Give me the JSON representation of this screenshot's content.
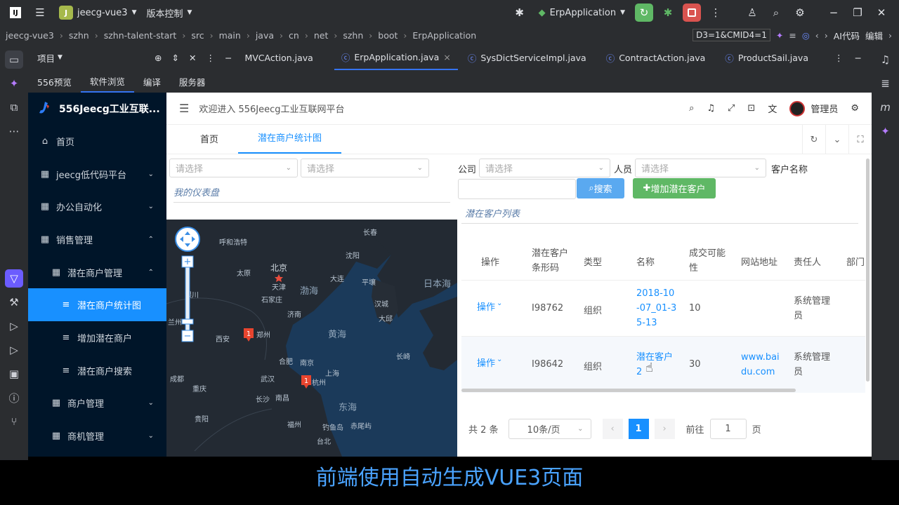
{
  "ide": {
    "project_badge": "J",
    "project_name": "jeecg-vue3",
    "vcs": "版本控制",
    "run_config": "ErpApplication",
    "ai_label": "AI代码",
    "edit_label": "编辑",
    "search_field": "D3=1&CMID4=1"
  },
  "breadcrumb": [
    "jeecg-vue3",
    "szhn",
    "szhn-talent-start",
    "src",
    "main",
    "java",
    "cn",
    "net",
    "szhn",
    "boot",
    "ErpApplication"
  ],
  "project_label": "项目",
  "file_tabs": [
    "MVCAction.java",
    "ErpApplication.java",
    "SysDictServiceImpl.java",
    "ContractAction.java",
    "ProductSail.java"
  ],
  "tool_tabs": [
    "556预览",
    "软件浏览",
    "编译",
    "服务器"
  ],
  "app": {
    "brand": "556Jeecg工业互联...",
    "welcome": "欢迎进入 556Jeecg工业互联网平台",
    "user": "管理员",
    "menu": [
      {
        "label": "首页",
        "level": 0,
        "arrow": ""
      },
      {
        "label": "jeecg低代码平台",
        "level": 0,
        "arrow": "⌄"
      },
      {
        "label": "办公自动化",
        "level": 0,
        "arrow": "⌄"
      },
      {
        "label": "销售管理",
        "level": 0,
        "arrow": "⌃"
      },
      {
        "label": "潜在商户管理",
        "level": 1,
        "arrow": "⌃"
      },
      {
        "label": "潜在商户统计图",
        "level": 2,
        "arrow": "",
        "selected": true
      },
      {
        "label": "增加潜在商户",
        "level": 2,
        "arrow": ""
      },
      {
        "label": "潜在商户搜索",
        "level": 2,
        "arrow": ""
      },
      {
        "label": "商户管理",
        "level": 1,
        "arrow": "⌄"
      },
      {
        "label": "商机管理",
        "level": 1,
        "arrow": "⌄"
      }
    ],
    "tabs": [
      "首页",
      "潜在商户统计图"
    ],
    "filters": {
      "placeholder": "请选择",
      "company_label": "公司",
      "person_label": "人员",
      "customer_name_label": "客户名称"
    },
    "search_btn": "搜索",
    "add_btn": "增加潜在客户",
    "dashboard_title": "我的仪表盘",
    "list_title": "潜在客户列表",
    "table": {
      "headers": [
        "操作",
        "潜在客户条形码",
        "类型",
        "名称",
        "成交可能性",
        "网站地址",
        "责任人",
        "部门"
      ],
      "rows": [
        {
          "op": "操作",
          "code": "I98762",
          "type": "组织",
          "name": "2018-10-07_01-35-13",
          "prob": "10",
          "site": "",
          "owner": "系统管理员"
        },
        {
          "op": "操作",
          "code": "I98642",
          "type": "组织",
          "name": "潜在客户2",
          "prob": "30",
          "site": "www.baidu.com",
          "owner": "系统管理员"
        }
      ]
    },
    "pager": {
      "total": "共 2 条",
      "page_size": "10条/页",
      "current": "1",
      "goto_label": "前往",
      "goto_value": "1",
      "page_suffix": "页"
    },
    "map_labels": {
      "beijing": "北京",
      "tianjin": "天津",
      "shijiazhuang": "石家庄",
      "bohai": "渤海",
      "huanghai": "黄海",
      "donghai": "东海",
      "riben_hai": "日本海",
      "changchun": "长春",
      "shenyang": "沈阳",
      "dalian": "大连",
      "pingrang": "平壤",
      "hancheng": "汉城",
      "jinan": "济南",
      "dajiu": "大邱",
      "yinchuan": "银川",
      "xian": "西安",
      "zhengzhou": "郑州",
      "lanzhou": "兰州",
      "chengdu": "成都",
      "chongqing": "重庆",
      "wuhan": "武汉",
      "hefei": "合肥",
      "nanjing": "南京",
      "shanghai": "上海",
      "hangzhou": "杭州",
      "changsha": "长沙",
      "nanchang": "南昌",
      "guiyang": "贵阳",
      "fuzhou": "福州",
      "taibei": "台北",
      "diaoyudao": "钓鱼岛",
      "chiweiyu": "赤尾屿",
      "changqi": "长崎",
      "huhehaote": "呼和浩特",
      "taiyuan": "太原",
      "marker": "1"
    }
  },
  "caption": "前端使用自动生成VUE3页面"
}
